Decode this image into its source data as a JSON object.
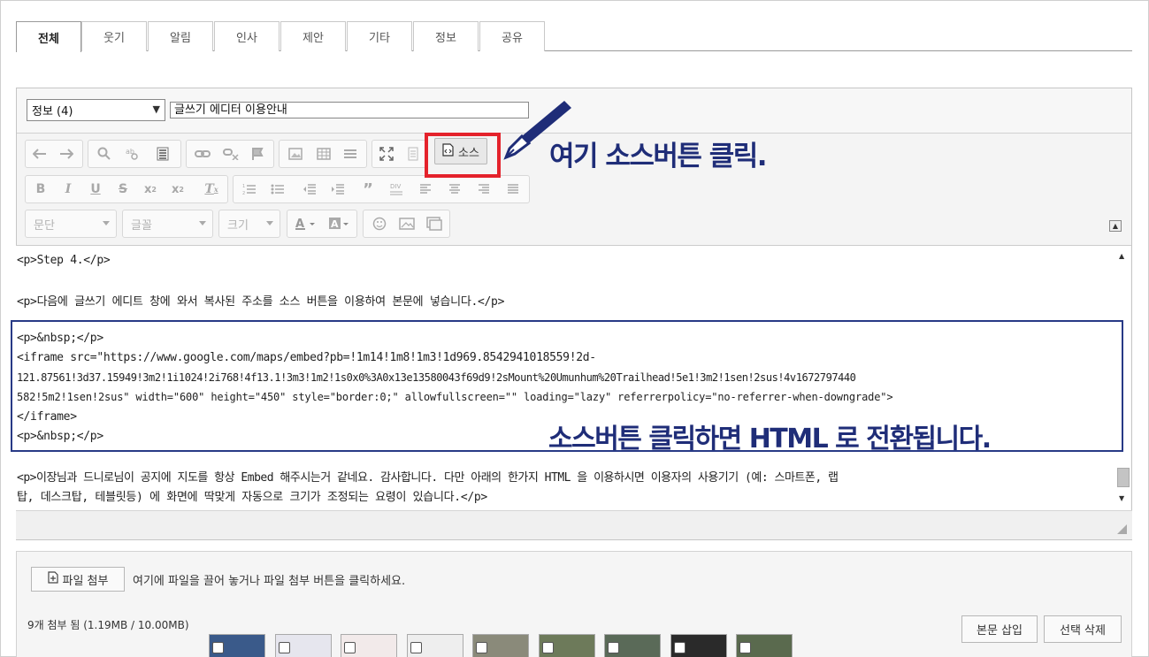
{
  "tabs": [
    "전체",
    "웃기",
    "알림",
    "인사",
    "제안",
    "기타",
    "정보",
    "공유"
  ],
  "category": {
    "value": "정보 (4)"
  },
  "title": {
    "value": "글쓰기 에디터 이용안내"
  },
  "toolbar": {
    "source_label": "소스",
    "paragraph_combo": "문단",
    "font_combo": "글꼴",
    "size_combo": "크기"
  },
  "annotations": {
    "click_source": "여기 소스버튼 클릭.",
    "html_switch": "소스버튼 클릭하면 HTML 로 전환됩니다."
  },
  "source_lines": [
    "<p>Step 4.</p>",
    "<p>다음에 글쓰기 에디트 창에 와서 복사된 주소를 소스 버튼을 이용하여 본문에 넣습니다.</p>",
    "<p>&nbsp;</p>",
    "<iframe src=\"https://www.google.com/maps/embed?pb=!1m14!1m8!1m3!1d969.8542941018559!2d-",
    "121.87561!3d37.15949!3m2!1i1024!2i768!4f13.1!3m3!1m2!1s0x0%3A0x13e13580043f69d9!2sMount%20Umunhum%20Trailhead!5e1!3m2!1sen!2sus!4v1672797440",
    "582!5m2!1sen!2sus\" width=\"600\" height=\"450\" style=\"border:0;\" allowfullscreen=\"\" loading=\"lazy\" referrerpolicy=\"no-referrer-when-downgrade\">",
    "</iframe>",
    "<p>&nbsp;</p>",
    "<p>이장님과 드니로님이 공지에 지도를 항상 Embed 해주시는거 같네요. 감사합니다. 다만 아래의 한가지 HTML 을 이용하시면 이용자의 사용기기 (예: 스마트폰, 랩",
    "탑, 데스크탑, 테블릿등) 에 화면에 딱맞게 자동으로 크기가 조정되는 요령이 있습니다.</p>"
  ],
  "attach": {
    "button_label": "파일 첨부",
    "hint": "여기에 파일을 끌어 놓거나 파일 첨부 버튼을 클릭하세요.",
    "count_text": "9개 첨부 됨 (1.19MB / 10.00MB)",
    "insert_label": "본문 삽입",
    "delete_label": "선택 삭제",
    "thumbnail_count": 9
  },
  "colors": {
    "highlight_red": "#e4222b",
    "annotation_navy": "#1f2d78",
    "box_navy": "#283a86"
  }
}
